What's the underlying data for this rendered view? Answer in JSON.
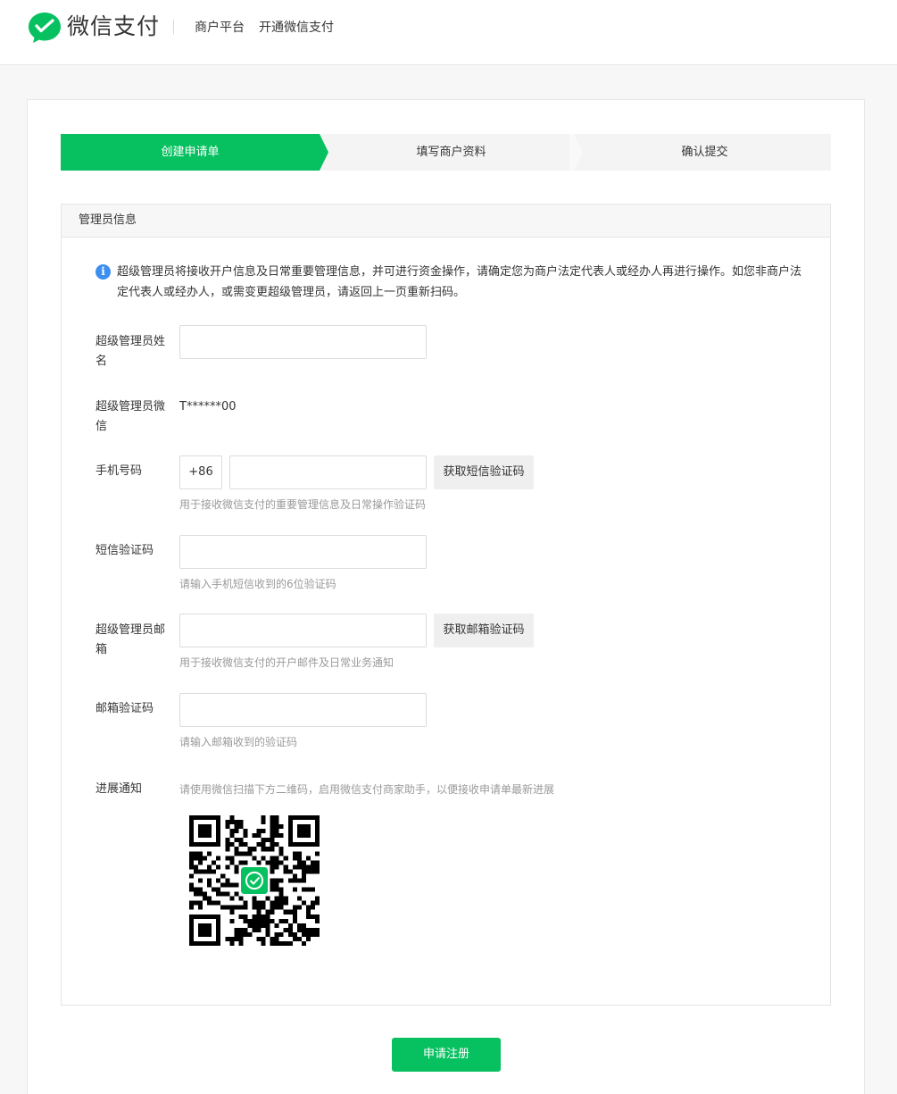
{
  "header": {
    "logo_text": "微信支付",
    "platform": "商户平台",
    "page": "开通微信支付",
    "brand_color": "#07c160"
  },
  "steps": [
    {
      "label": "创建申请单",
      "active": true
    },
    {
      "label": "填写商户资料",
      "active": false
    },
    {
      "label": "确认提交",
      "active": false
    }
  ],
  "section": {
    "title": "管理员信息",
    "notice_icon": "info-icon",
    "notice": "超级管理员将接收开户信息及日常重要管理信息，并可进行资金操作，请确定您为商户法定代表人或经办人再进行操作。如您非商户法定代表人或经办人，或需变更超级管理员，请返回上一页重新扫码。"
  },
  "form": {
    "name": {
      "label": "超级管理员姓名",
      "value": ""
    },
    "wechat": {
      "label": "超级管理员微信",
      "value": "T******00"
    },
    "phone": {
      "label": "手机号码",
      "prefix": "+86",
      "value": "",
      "button": "获取短信验证码",
      "hint": "用于接收微信支付的重要管理信息及日常操作验证码"
    },
    "sms_code": {
      "label": "短信验证码",
      "value": "",
      "hint": "请输入手机短信收到的6位验证码"
    },
    "email": {
      "label": "超级管理员邮箱",
      "value": "",
      "button": "获取邮箱验证码",
      "hint": "用于接收微信支付的开户邮件及日常业务通知"
    },
    "email_code": {
      "label": "邮箱验证码",
      "value": "",
      "hint": "请输入邮箱收到的验证码"
    },
    "progress": {
      "label": "进展通知",
      "hint": "请使用微信扫描下方二维码，启用微信支付商家助手，以便接收申请单最新进展",
      "qr_icon": "qr-code-icon"
    }
  },
  "submit_label": "申请注册"
}
